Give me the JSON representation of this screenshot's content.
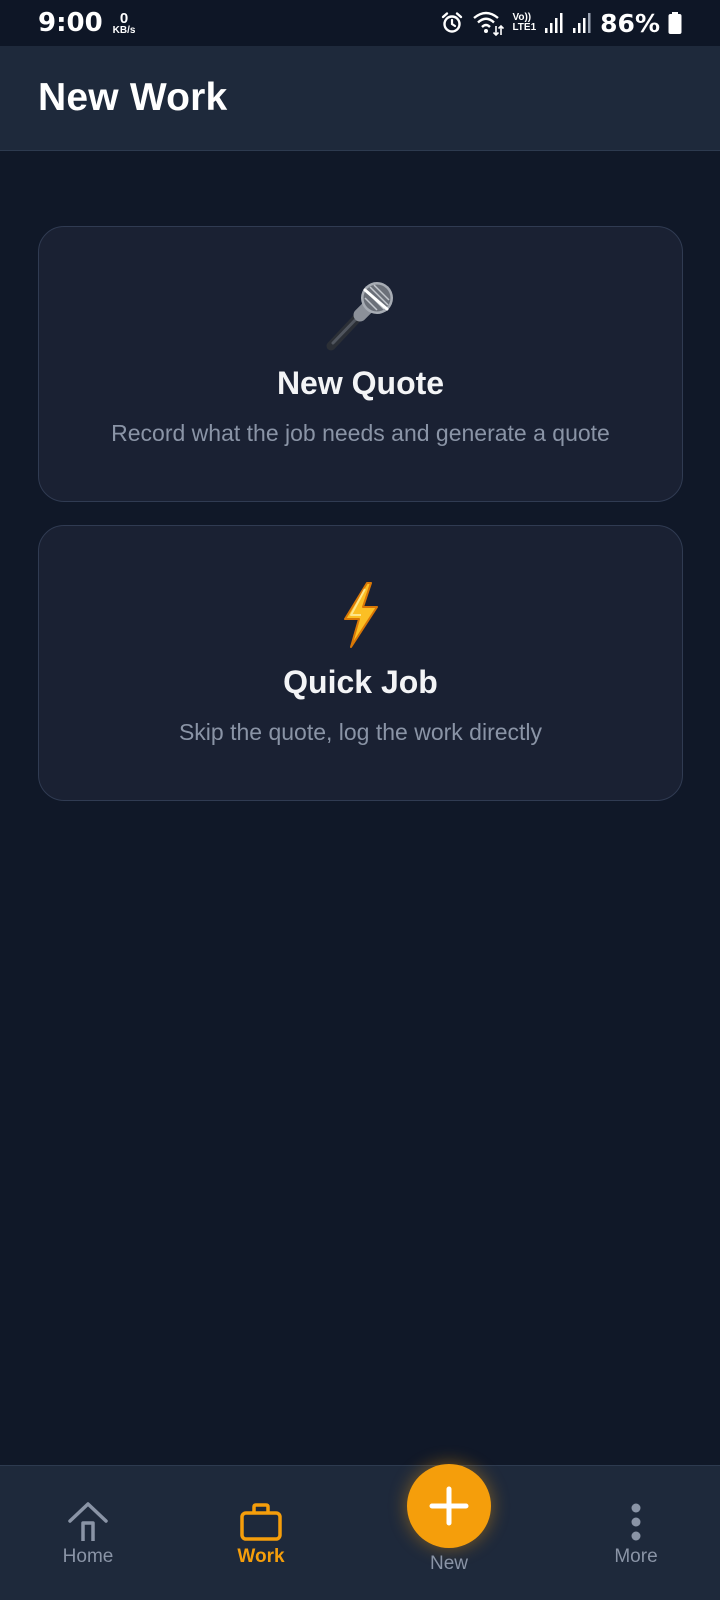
{
  "status_bar": {
    "time": "9:00",
    "net_speed_value": "0",
    "net_speed_unit": "KB/s",
    "volte_top": "Vo))",
    "volte_bottom": "LTE1",
    "battery": "86%"
  },
  "header": {
    "title": "New Work"
  },
  "cards": [
    {
      "icon": "microphone-icon",
      "title": "New Quote",
      "description": "Record what the job needs and generate a quote"
    },
    {
      "icon": "lightning-icon",
      "title": "Quick Job",
      "description": "Skip the quote, log the work directly"
    }
  ],
  "bottom_nav": {
    "items": [
      {
        "label": "Home",
        "icon": "home-icon",
        "active": false
      },
      {
        "label": "Work",
        "icon": "briefcase-icon",
        "active": true
      },
      {
        "label": "New",
        "icon": "plus-icon",
        "active": false
      },
      {
        "label": "More",
        "icon": "more-vertical-icon",
        "active": false
      }
    ]
  },
  "colors": {
    "background": "#101828",
    "surface": "#1e293b",
    "card": "#1a2133",
    "accent": "#f59e0b",
    "muted_text": "#8a94a6"
  }
}
